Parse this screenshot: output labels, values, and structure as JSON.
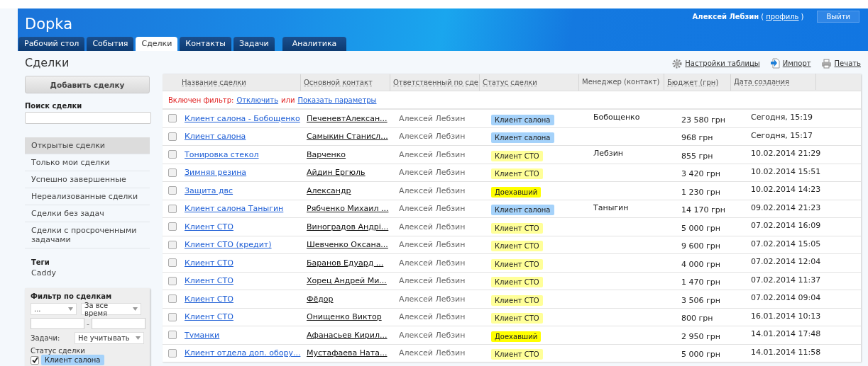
{
  "header": {
    "logo": "Dopka",
    "user": "Алексей Лебзин",
    "paren_open": "(",
    "profile_link": "профиль",
    "paren_close": ")",
    "logout": "Выйти"
  },
  "tabs": [
    {
      "label": "Рабочий стол",
      "selected": false
    },
    {
      "label": "События",
      "selected": false
    },
    {
      "label": "Сделки",
      "selected": true
    },
    {
      "label": "Контакты",
      "selected": false
    },
    {
      "label": "Задачи",
      "selected": false
    },
    {
      "label": "Аналитика",
      "selected": false
    }
  ],
  "page_title": "Сделки",
  "toolbar": [
    {
      "label": "Настройки таблицы",
      "kind": "settings"
    },
    {
      "label": "Импорт",
      "kind": "import"
    },
    {
      "label": "Печать",
      "kind": "print"
    }
  ],
  "sidebar": {
    "add_button": "Добавить сделку",
    "search_label": "Поиск сделки",
    "views": [
      {
        "label": "Открытые сделки",
        "selected": true
      },
      {
        "label": "Только мои сделки",
        "selected": false
      },
      {
        "label": "Успешно завершенные",
        "selected": false
      },
      {
        "label": "Нереализованные сделки",
        "selected": false
      },
      {
        "label": "Сделки без задач",
        "selected": false
      },
      {
        "label": "Сделки с просроченными задачами",
        "selected": false
      }
    ],
    "tags_label": "Теги",
    "tags": [
      "Caddy"
    ],
    "filter": {
      "title": "Фильтр по сделкам",
      "select_1": "...",
      "period": "За все время",
      "range_separator": "-",
      "tasks_label": "Задачи:",
      "tasks_value": "Не учитывать",
      "status_label": "Статус сделки",
      "statuses": [
        {
          "label": "Клиент салона",
          "checked": true,
          "color": "#a5d2fa"
        }
      ]
    }
  },
  "table": {
    "columns": [
      "Название сделки",
      "Основной контакт",
      "Ответственный по сде",
      "Статус сделки",
      "Менеджер (контакт)",
      "Бюджет (грн)",
      "Дата создания"
    ],
    "filter_notice": {
      "label": "Включен фильтр:",
      "disable": "Отключить",
      "or": "или",
      "show": "Показать параметры"
    },
    "rows": [
      {
        "name": "Клиент салона - Бобощенко",
        "contact": "ПеченевтАлексан...",
        "owner": "Алексей Лебзин",
        "status": "Клиент салона",
        "color": "#a5d2fa",
        "manager": "Бобощенко",
        "budget": "23 580 грн",
        "date": "Сегодня, 15:19",
        "checked": false
      },
      {
        "name": "Клиент салона",
        "contact": "Самыкин Станисл...",
        "owner": "Алексей Лебзин",
        "status": "Клиент салона",
        "color": "#a5d2fa",
        "manager": "",
        "budget": "968 грн",
        "date": "Сегодня, 15:17",
        "checked": false
      },
      {
        "name": "Тонировка стекол",
        "contact": "Варченко",
        "owner": "Алексей Лебзин",
        "status": "Клиент СТО",
        "color": "#ffff99",
        "manager": "Лебзин",
        "budget": "855 грн",
        "date": "10.02.2014 21:29",
        "checked": false
      },
      {
        "name": "Зимняя резина",
        "contact": "Айдин Ергюль",
        "owner": "Алексей Лебзин",
        "status": "Клиент СТО",
        "color": "#ffff99",
        "manager": "",
        "budget": "3 420 грн",
        "date": "10.02.2014 15:51",
        "checked": false
      },
      {
        "name": "Защита двс",
        "contact": "Александр",
        "owner": "Алексей Лебзин",
        "status": "Доехавший",
        "color": "#ffff00",
        "manager": "",
        "budget": "1 230 грн",
        "date": "10.02.2014 14:23",
        "checked": false
      },
      {
        "name": "Клиент салона Таныгин",
        "contact": "Рябченко Михаил ...",
        "owner": "Алексей Лебзин",
        "status": "Клиент салона",
        "color": "#a5d2fa",
        "manager": "Таныгин",
        "budget": "14 170 грн",
        "date": "09.02.2014 21:23",
        "checked": false
      },
      {
        "name": "Клиент СТО",
        "contact": "Виноградов Андрі...",
        "owner": "Алексей Лебзин",
        "status": "Клиент СТО",
        "color": "#ffff99",
        "manager": "",
        "budget": "5 000 грн",
        "date": "07.02.2014 16:09",
        "checked": false
      },
      {
        "name": "Клиент СТО (кредит)",
        "contact": "Шевченко Оксана...",
        "owner": "Алексей Лебзин",
        "status": "Клиент СТО",
        "color": "#ffff99",
        "manager": "",
        "budget": "9 600 грн",
        "date": "07.02.2014 15:05",
        "checked": false
      },
      {
        "name": "Клиент СТО",
        "contact": "Баранов Едуард ...",
        "owner": "Алексей Лебзин",
        "status": "Клиент СТО",
        "color": "#ffff99",
        "manager": "",
        "budget": "4 000 грн",
        "date": "07.02.2014 12:04",
        "checked": false
      },
      {
        "name": "Клиент СТО",
        "contact": "Хорец Андрей Ми...",
        "owner": "Алексей Лебзин",
        "status": "Клиент СТО",
        "color": "#ffff99",
        "manager": "",
        "budget": "1 470 грн",
        "date": "07.02.2014 11:37",
        "checked": false
      },
      {
        "name": "Клиент СТО",
        "contact": "Фёдор",
        "owner": "Алексей Лебзин",
        "status": "Клиент СТО",
        "color": "#ffff99",
        "manager": "",
        "budget": "3 506 грн",
        "date": "07.02.2014 09:04",
        "checked": false
      },
      {
        "name": "Клиент СТО",
        "contact": "Онищенко Виктор",
        "owner": "Алексей Лебзин",
        "status": "Клиент СТО",
        "color": "#ffff99",
        "manager": "",
        "budget": "800 грн",
        "date": "16.01.2014 10:13",
        "checked": false
      },
      {
        "name": "Туманки",
        "contact": "Афанасьев Кирил...",
        "owner": "Алексей Лебзин",
        "status": "Доехавший",
        "color": "#ffff00",
        "manager": "",
        "budget": "2 950 грн",
        "date": "14.01.2014 17:48",
        "checked": false
      },
      {
        "name": "Клиент отдела доп. обору...",
        "contact": "Мустафаева Ната...",
        "owner": "Алексей Лебзин",
        "status": "Клиент СТО",
        "color": "#ffff99",
        "manager": "",
        "budget": "5 000 грн",
        "date": "14.01.2014 11:58",
        "checked": false
      }
    ]
  }
}
